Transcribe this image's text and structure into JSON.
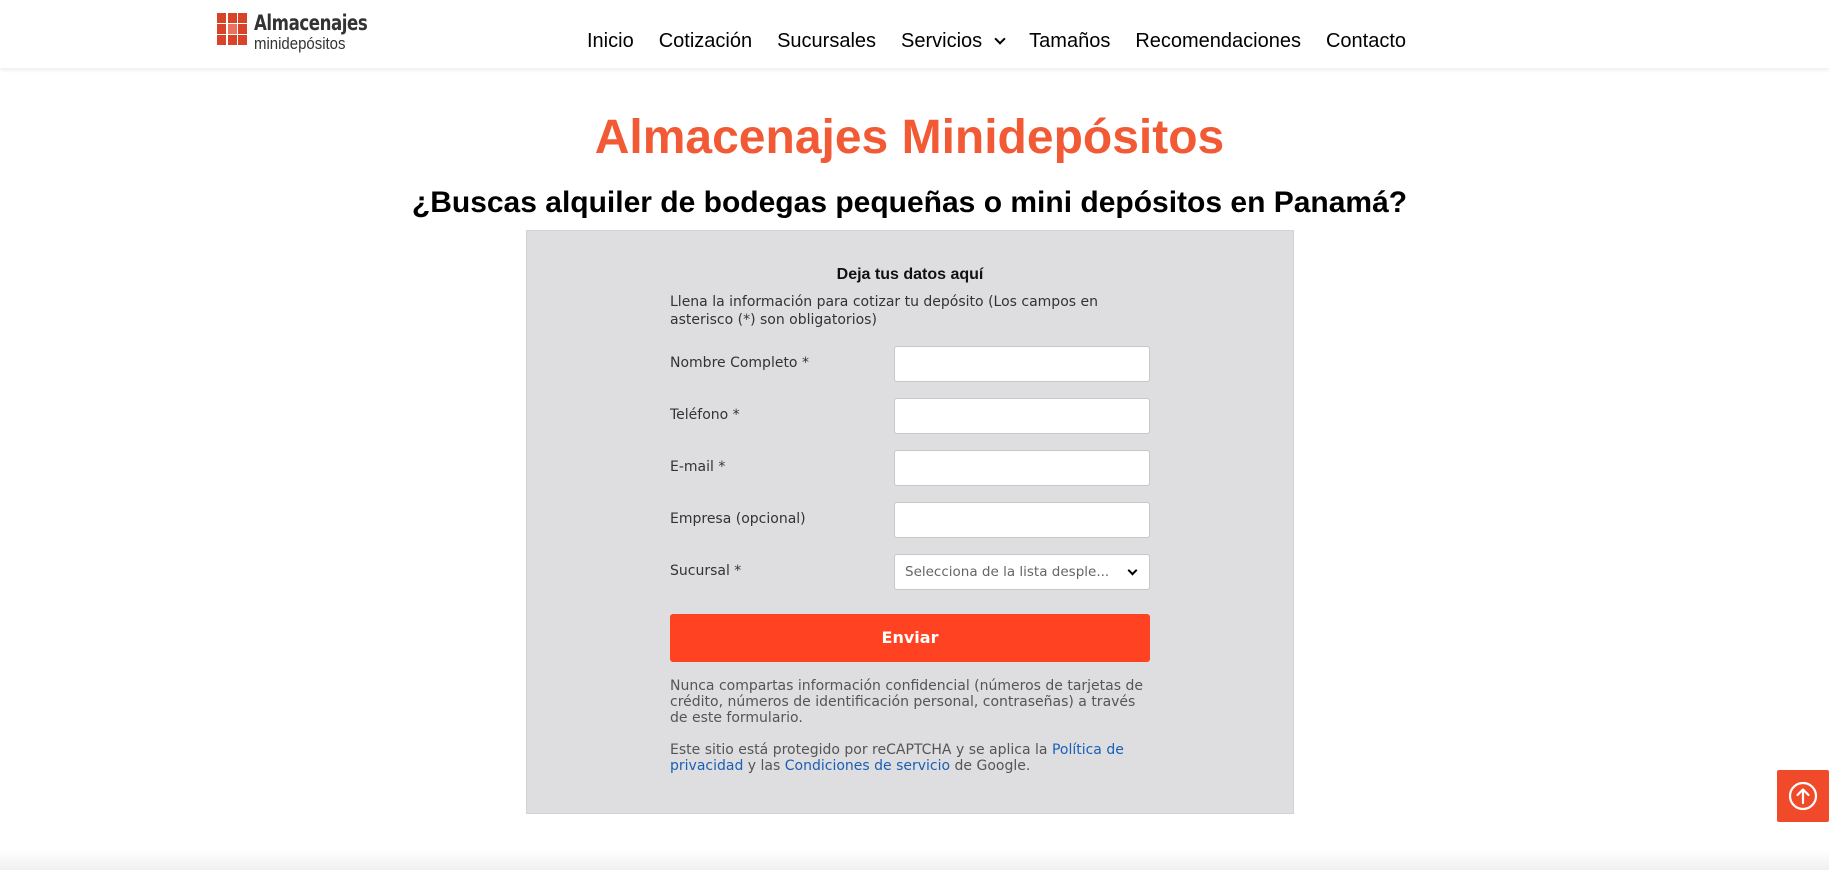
{
  "header": {
    "logo": {
      "line1": "Almacenajes",
      "line2": "minidepósitos"
    },
    "nav": [
      {
        "label": "Inicio"
      },
      {
        "label": "Cotización"
      },
      {
        "label": "Sucursales"
      },
      {
        "label": "Servicios",
        "dropdown": true
      },
      {
        "label": "Tamaños"
      },
      {
        "label": "Recomendaciones"
      },
      {
        "label": "Contacto"
      }
    ]
  },
  "hero": {
    "title": "Almacenajes Minidepósitos",
    "subtitle": "¿Buscas alquiler de bodegas pequeñas o mini depósitos en Panamá?"
  },
  "form": {
    "title": "Deja tus datos aquí",
    "intro": "Llena la información para cotizar tu depósito (Los campos en asterisco (*) son obligatorios)",
    "fields": [
      {
        "label": "Nombre Completo *",
        "value": ""
      },
      {
        "label": "Teléfono *",
        "value": ""
      },
      {
        "label": "E-mail *",
        "value": ""
      },
      {
        "label": "Empresa (opcional)",
        "value": ""
      }
    ],
    "branch": {
      "label": "Sucursal *",
      "selected": "Selecciona de la lista desple..."
    },
    "submit_label": "Enviar",
    "privacy_note": "Nunca compartas información confidencial (números de tarjetas de crédito, números de identificación personal, contraseñas) a través de este formulario.",
    "recaptcha": {
      "prefix": "Este sitio está protegido por reCAPTCHA y se aplica la ",
      "privacy_link": "Política de privacidad",
      "middle": " y las ",
      "terms_link": "Condiciones de servicio",
      "suffix": " de Google."
    }
  },
  "colors": {
    "accent": "#f25a35",
    "button": "#ff4221",
    "panel": "#dedee0",
    "link": "#1a5fb4"
  },
  "icons": {
    "back_to_top": "arrow-up-circle-icon",
    "dropdown": "chevron-down-icon"
  }
}
